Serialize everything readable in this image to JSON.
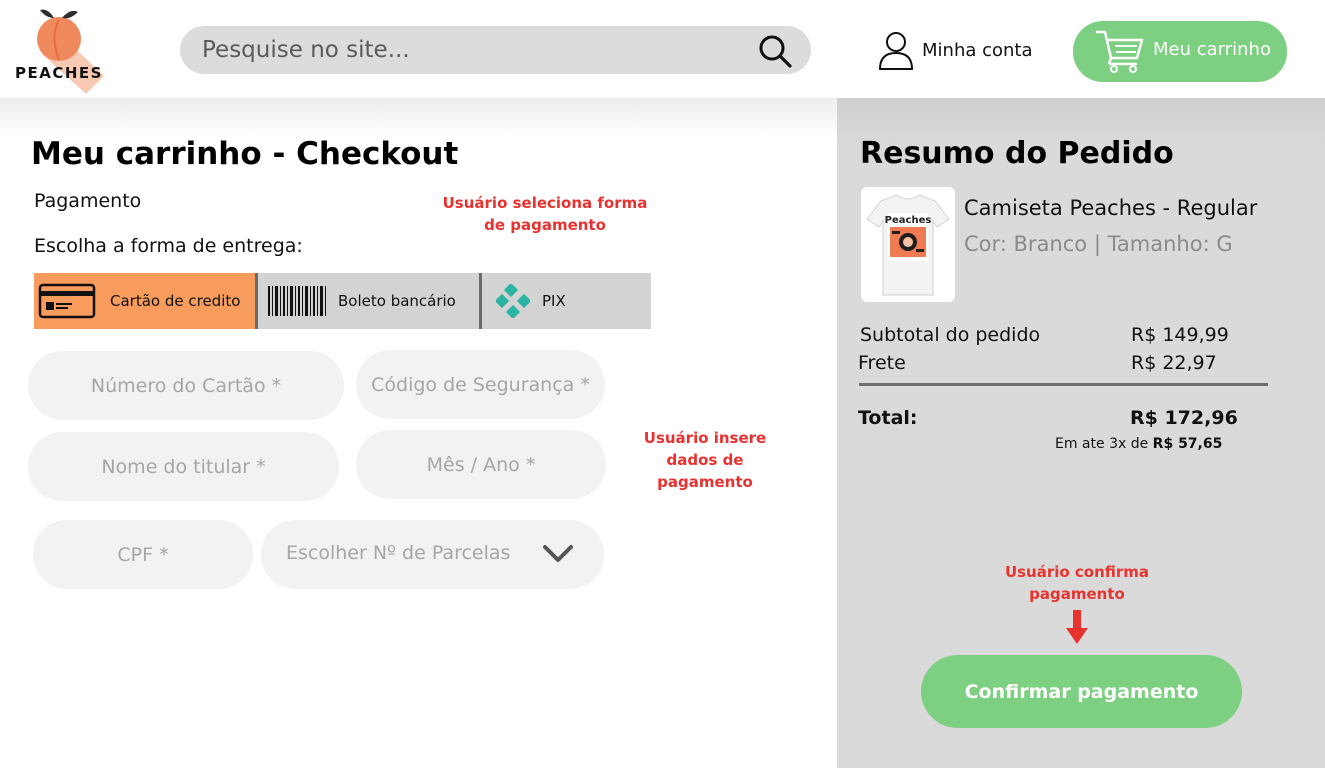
{
  "header": {
    "logo_text": "PEACHES",
    "search_placeholder": "Pesquise no site...",
    "account_label": "Minha conta",
    "cart_label": "Meu carrinho"
  },
  "checkout": {
    "title": "Meu carrinho - Checkout",
    "payment_label": "Pagamento",
    "delivery_label": "Escolha a forma de entrega:",
    "annotation_select": "Usuário seleciona forma de pagamento",
    "annotation_insert": "Usuário insere dados de pagamento",
    "payment_methods": [
      {
        "label": "Cartão de credito",
        "icon": "credit-card-icon",
        "selected": true
      },
      {
        "label": "Boleto bancário",
        "icon": "barcode-icon",
        "selected": false
      },
      {
        "label": "PIX",
        "icon": "pix-icon",
        "selected": false
      }
    ],
    "fields": {
      "card_number": "Número do Cartão *",
      "security_code": "Código de Segurança *",
      "holder_name": "Nome do titular *",
      "expiry": "Mês / Ano *",
      "cpf": "CPF *",
      "installments": "Escolher Nº de Parcelas"
    }
  },
  "summary": {
    "title": "Resumo do Pedido",
    "product": {
      "name": "Camiseta Peaches - Regular",
      "variant": "Cor: Branco | Tamanho: G",
      "image_text": "Peaches"
    },
    "subtotal_label": "Subtotal do pedido",
    "subtotal_value": "R$ 149,99",
    "shipping_label": "Frete",
    "shipping_value": "R$ 22,97",
    "total_label": "Total:",
    "total_value": "R$ 172,96",
    "installment_prefix": "Em ate 3x de",
    "installment_value": "R$ 57,65",
    "annotation_confirm": "Usuário confirma pagamento",
    "confirm_button": "Confirmar pagamento"
  },
  "colors": {
    "accent_green": "#7dcf81",
    "selected_tab": "#f79c5c",
    "annotation_red": "#e8322f",
    "summary_bg": "#dadada"
  }
}
